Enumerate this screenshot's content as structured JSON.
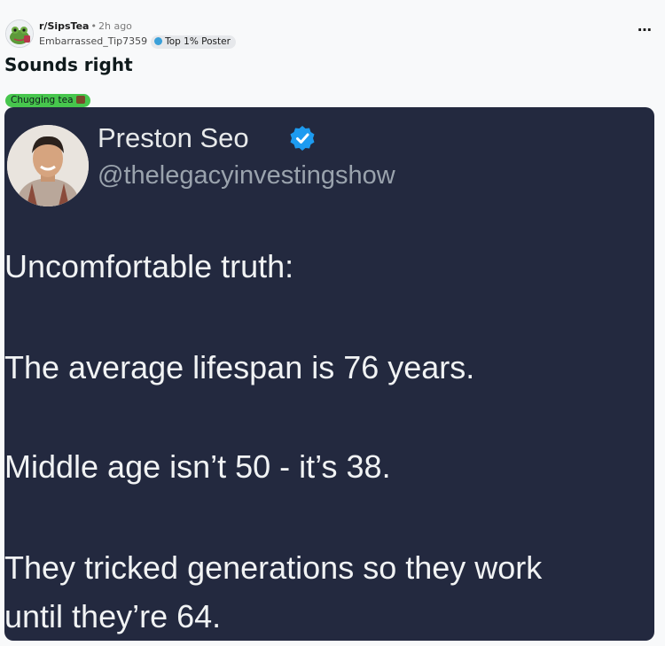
{
  "post": {
    "subreddit": "r/SipsTea",
    "separator": "•",
    "time_ago": "2h ago",
    "username": "Embarrassed_Tip7359",
    "user_flair": "Top 1% Poster",
    "more_icon": "⋯",
    "title": "Sounds right",
    "post_flair": "Chugging tea"
  },
  "tweet": {
    "name": "Preston Seo",
    "handle": "@thelegacyinvestingshow",
    "lines": [
      "Uncomfortable truth:",
      "The average lifespan is 76 years.",
      "Middle age isn’t 50 - it’s 38.",
      "They tricked generations so they work",
      "until they’re 64."
    ]
  },
  "colors": {
    "page_bg": "#f8f9fa",
    "tweet_bg": "#23293f",
    "post_flair_bg": "#47c64d",
    "verified_badge": "#1d9bf0"
  },
  "icons": {
    "subreddit_avatar": "frog-avatar-icon",
    "user_flair_icon": "globe-icon",
    "post_flair_icon": "tea-emoji-icon",
    "more": "ellipsis-icon",
    "verified": "verified-badge-icon"
  }
}
